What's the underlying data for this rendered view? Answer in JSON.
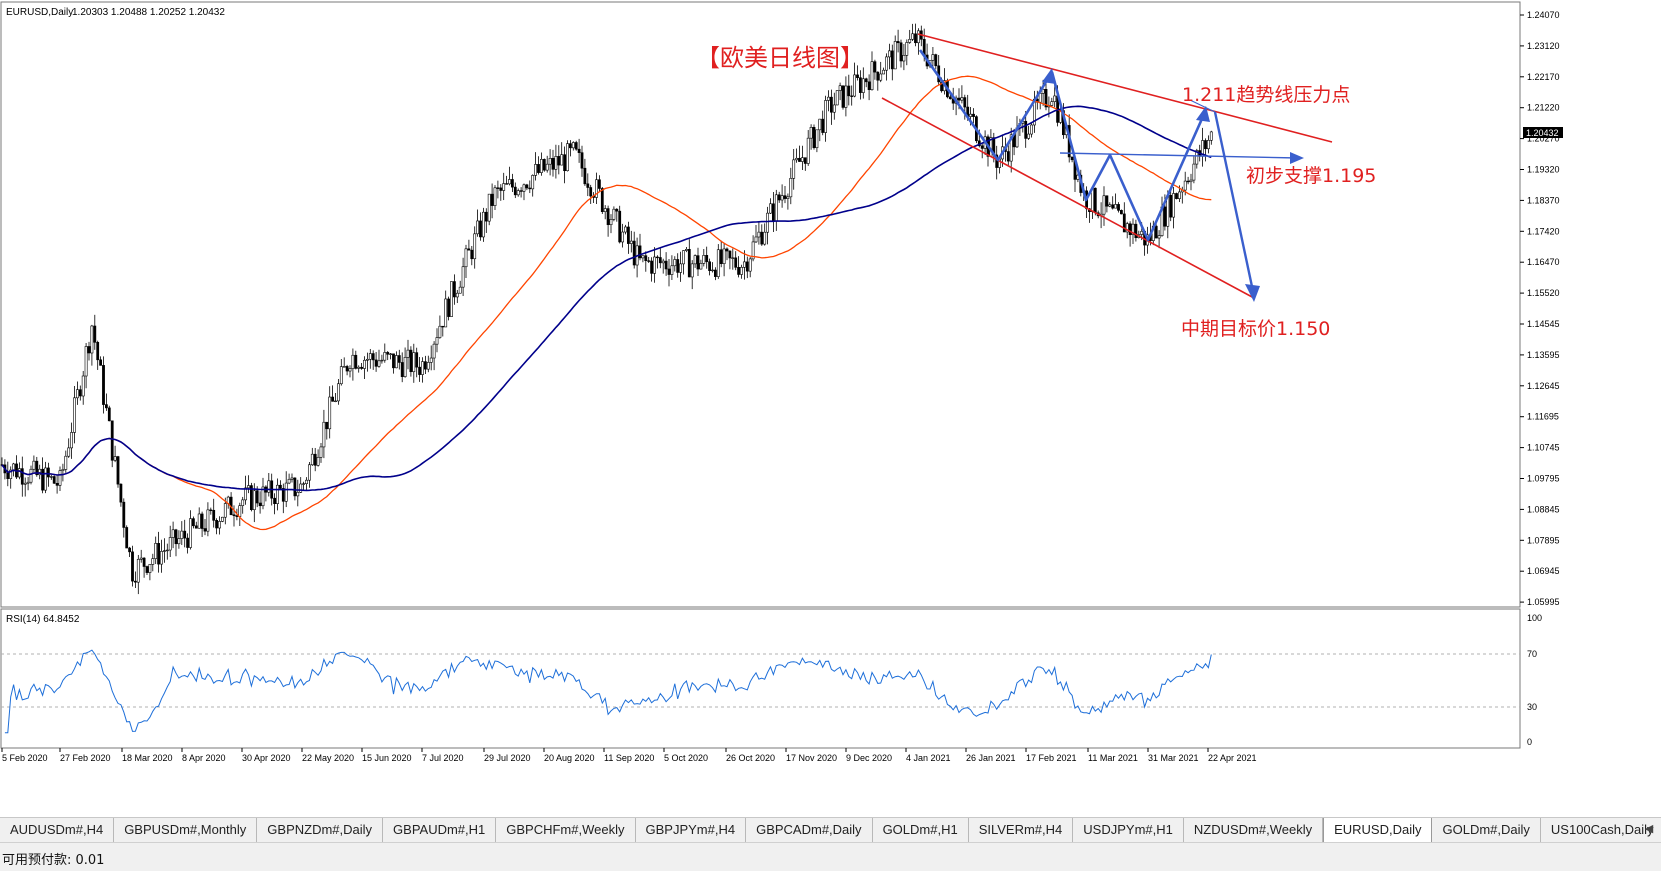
{
  "header": {
    "symbol": "EURUSD,Daily",
    "ohlc": "1.20303 1.20488 1.20252 1.20432"
  },
  "price_axis": {
    "labels": [
      "1.24070",
      "1.23120",
      "1.22170",
      "1.21220",
      "1.20270",
      "1.19320",
      "1.18370",
      "1.17420",
      "1.16470",
      "1.15520",
      "1.14545",
      "1.13595",
      "1.12645",
      "1.11695",
      "1.10745",
      "1.09795",
      "1.08845",
      "1.07895",
      "1.06945",
      "1.05995"
    ],
    "current_price": "1.20432"
  },
  "rsi": {
    "label": "RSI(14) 64.8452",
    "levels": [
      "100",
      "70",
      "30",
      "0"
    ]
  },
  "time_axis": {
    "labels": [
      "5 Feb 2020",
      "27 Feb 2020",
      "18 Mar 2020",
      "8 Apr 2020",
      "30 Apr 2020",
      "22 May 2020",
      "15 Jun 2020",
      "7 Jul 2020",
      "29 Jul 2020",
      "20 Aug 2020",
      "11 Sep 2020",
      "5 Oct 2020",
      "26 Oct 2020",
      "17 Nov 2020",
      "9 Dec 2020",
      "4 Jan 2021",
      "26 Jan 2021",
      "17 Feb 2021",
      "11 Mar 2021",
      "31 Mar 2021",
      "22 Apr 2021"
    ]
  },
  "annotations": {
    "title": "【欧美日线图】",
    "resistance": "1.211趋势线压力点",
    "support": "初步支撑1.195",
    "target": "中期目标价1.150"
  },
  "tabs": [
    "AUDUSDm#,H4",
    "GBPUSDm#,Monthly",
    "GBPNZDm#,Daily",
    "GBPAUDm#,H1",
    "GBPCHFm#,Weekly",
    "GBPJPYm#,H4",
    "GBPCADm#,Daily",
    "GOLDm#,H1",
    "SILVERm#,H4",
    "USDJPYm#,H1",
    "NZDUSDm#,Weekly",
    "EURUSD,Daily",
    "GOLDm#,Daily",
    "US100Cash,Daily"
  ],
  "active_tab": "EURUSD,Daily",
  "status": {
    "text": "可用预付款: 0.01"
  },
  "colors": {
    "bull": "#ffffff",
    "bear": "#000000",
    "ma_fast": "#ff4500",
    "ma_slow": "#00008b",
    "trendline": "#e02020",
    "arrow": "#3a5fcd",
    "rsi_line": "#1e6fd9",
    "annotation_text": "#e02020"
  },
  "chart_data": {
    "type": "candlestick",
    "symbol": "EURUSD",
    "timeframe": "Daily",
    "price_range": [
      1.0565,
      1.244
    ],
    "key_points": [
      {
        "date": "5 Feb 2020",
        "close": 1.101
      },
      {
        "date": "27 Feb 2020",
        "close": 1.095
      },
      {
        "date": "9 Mar 2020",
        "close": 1.145
      },
      {
        "date": "23 Mar 2020",
        "close": 1.068
      },
      {
        "date": "30 Apr 2020",
        "close": 1.09
      },
      {
        "date": "22 May 2020",
        "close": 1.094
      },
      {
        "date": "10 Jun 2020",
        "close": 1.135
      },
      {
        "date": "7 Jul 2020",
        "close": 1.132
      },
      {
        "date": "31 Jul 2020",
        "close": 1.185
      },
      {
        "date": "1 Sep 2020",
        "close": 1.198
      },
      {
        "date": "25 Sep 2020",
        "close": 1.164
      },
      {
        "date": "2 Nov 2020",
        "close": 1.164
      },
      {
        "date": "4 Dec 2020",
        "close": 1.213
      },
      {
        "date": "6 Jan 2021",
        "close": 1.234
      },
      {
        "date": "29 Jan 2021",
        "close": 1.196
      },
      {
        "date": "25 Feb 2021",
        "close": 1.218
      },
      {
        "date": "9 Mar 2021",
        "close": 1.185
      },
      {
        "date": "31 Mar 2021",
        "close": 1.171
      },
      {
        "date": "22 Apr 2021",
        "close": 1.2043
      }
    ],
    "rsi_range": [
      0,
      100
    ],
    "rsi_value": 64.8452
  }
}
